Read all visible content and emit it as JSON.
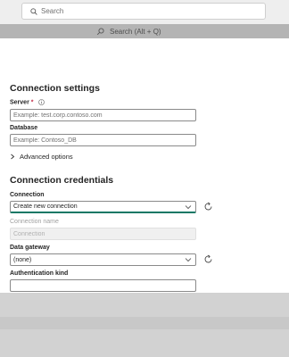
{
  "top_search": {
    "placeholder": "Search"
  },
  "command_search": {
    "label": "Search (Alt + Q)"
  },
  "connection_settings": {
    "title": "Connection settings",
    "server": {
      "label": "Server",
      "required_mark": "*",
      "placeholder": "Example: test.corp.contoso.com"
    },
    "database": {
      "label": "Database",
      "placeholder": "Example: Contoso_DB"
    },
    "advanced_options": "Advanced options"
  },
  "connection_credentials": {
    "title": "Connection credentials",
    "connection": {
      "label": "Connection",
      "value": "Create new connection"
    },
    "connection_name": {
      "label": "Connection name",
      "placeholder": "Connection"
    },
    "data_gateway": {
      "label": "Data gateway",
      "value": "(none)"
    },
    "authentication_kind": {
      "label": "Authentication kind"
    }
  },
  "icons": [
    "search-icon",
    "info-icon",
    "chevron-right-icon",
    "chevron-down-icon",
    "refresh-icon"
  ]
}
